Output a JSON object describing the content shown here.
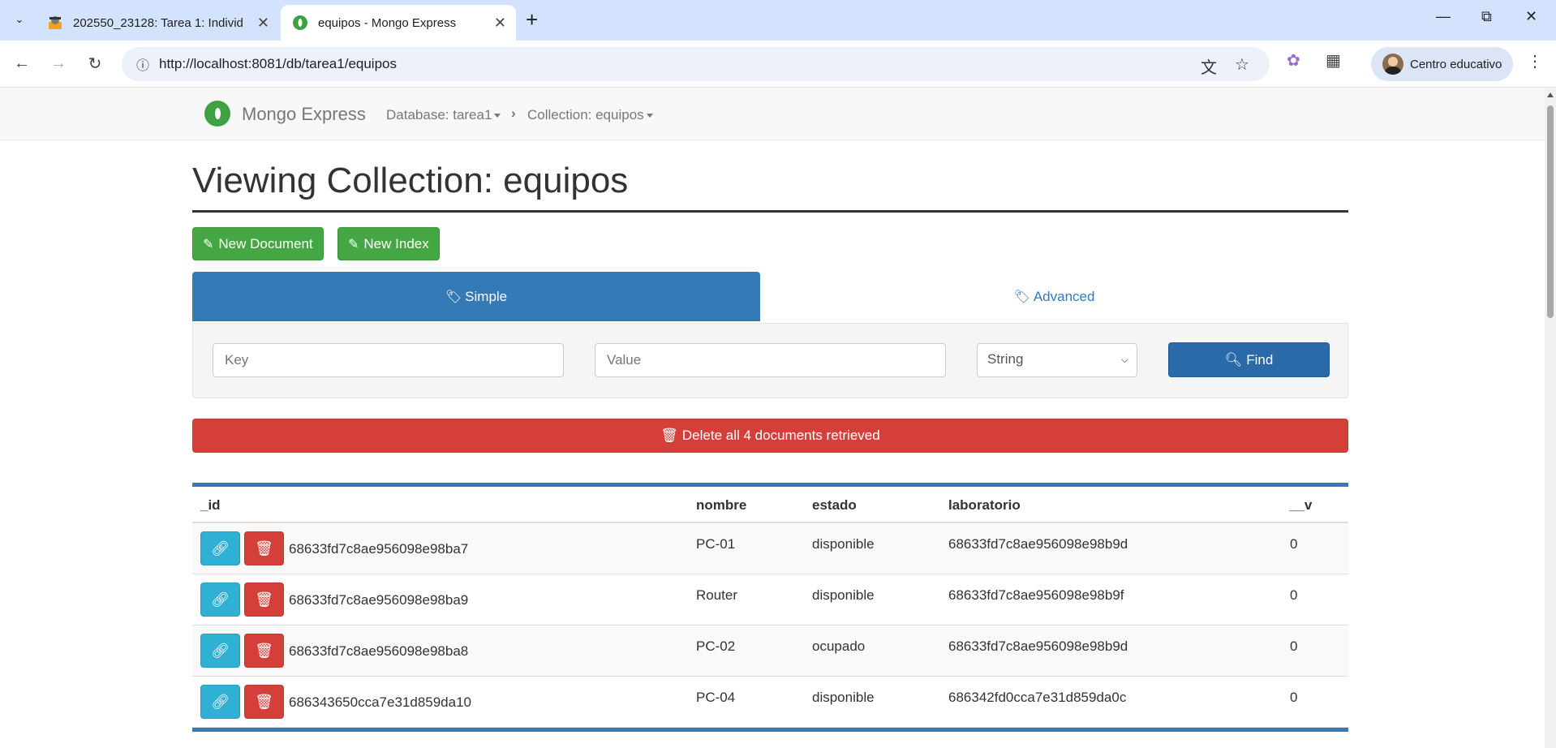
{
  "browser": {
    "tabs": [
      {
        "title": "202550_23128: Tarea 1: Individu",
        "active": false
      },
      {
        "title": "equipos - Mongo Express",
        "active": true
      }
    ],
    "url": "http://localhost:8081/db/tarea1/equipos",
    "profile_name": "Centro educativo"
  },
  "navbar": {
    "brand": "Mongo Express",
    "database_crumb": "Database: tarea1",
    "collection_crumb": "Collection: equipos"
  },
  "page": {
    "title": "Viewing Collection: equipos",
    "new_document_label": "New Document",
    "new_index_label": "New Index",
    "tab_simple_label": "Simple",
    "tab_advanced_label": "Advanced",
    "key_placeholder": "Key",
    "value_placeholder": "Value",
    "type_selected": "String",
    "find_label": "Find",
    "delete_all_label": "Delete all 4 documents retrieved"
  },
  "table": {
    "columns": [
      "_id",
      "nombre",
      "estado",
      "laboratorio",
      "__v"
    ],
    "rows": [
      {
        "_id": "68633fd7c8ae956098e98ba7",
        "nombre": "PC-01",
        "estado": "disponible",
        "laboratorio": "68633fd7c8ae956098e98b9d",
        "__v": "0"
      },
      {
        "_id": "68633fd7c8ae956098e98ba9",
        "nombre": "Router",
        "estado": "disponible",
        "laboratorio": "68633fd7c8ae956098e98b9f",
        "__v": "0"
      },
      {
        "_id": "68633fd7c8ae956098e98ba8",
        "nombre": "PC-02",
        "estado": "ocupado",
        "laboratorio": "68633fd7c8ae956098e98b9d",
        "__v": "0"
      },
      {
        "_id": "686343650cca7e31d859da10",
        "nombre": "PC-04",
        "estado": "disponible",
        "laboratorio": "686342fd0cca7e31d859da0c",
        "__v": "0"
      }
    ]
  },
  "colors": {
    "primary": "#337ab7",
    "success": "#44a744",
    "danger": "#d43f3a",
    "info": "#31b0d5",
    "brand_leaf": "#3fa144"
  },
  "icons": [
    "pencil-icon",
    "tag-icon",
    "tags-icon",
    "search-icon",
    "trash-icon",
    "link-icon",
    "leaf-icon"
  ]
}
